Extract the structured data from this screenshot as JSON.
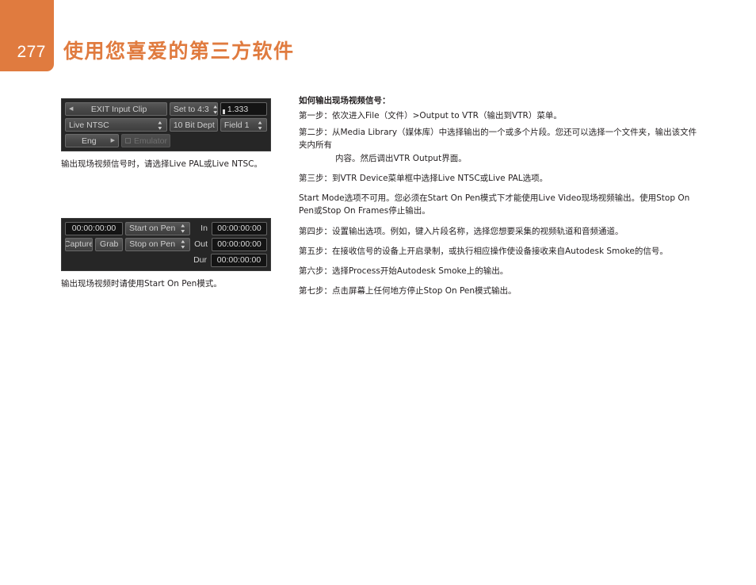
{
  "header": {
    "page_number": "277",
    "title": "使用您喜爱的第三方软件",
    "accent_color": "#e07b3f"
  },
  "figure1": {
    "panel_name": "vtr-output-settings-panel",
    "row1": {
      "clip_button": {
        "label": "EXIT Input Clip",
        "left_arrow": "◀"
      },
      "aspect_menu": {
        "label": "Set to 4:3",
        "spinner": "⇅"
      },
      "ratio_field": {
        "value": "1.333"
      }
    },
    "row2": {
      "device_menu": {
        "label": "Live NTSC",
        "spinner": "⇅"
      },
      "bit_depth_menu": {
        "label": "10 Bit Dept",
        "spinner": "⇅"
      },
      "field_menu": {
        "label": "Field 1",
        "spinner": "⇅"
      }
    },
    "row3": {
      "eng_button": {
        "label": "Eng",
        "right_arrow": "▶"
      },
      "emulator_toggle": {
        "label": "Emulator",
        "enabled": false
      }
    },
    "caption": "输出现场视频信号时，请选择Live PAL或Live NTSC。"
  },
  "figure2": {
    "panel_name": "capture-timecode-panel",
    "timecode_field": {
      "value": "00:00:00:00"
    },
    "capture_button": {
      "label": "Capture"
    },
    "grab_button": {
      "label": "Grab"
    },
    "start_mode_menu": {
      "label": "Start on Pen",
      "spinner": "⇅"
    },
    "stop_mode_menu": {
      "label": "Stop on Pen",
      "spinner": "⇅"
    },
    "in_label": "In",
    "in_value": "00:00:00:00",
    "out_label": "Out",
    "out_value": "00:00:00:00",
    "dur_label": "Dur",
    "dur_value": "00:00:00:00",
    "caption": "输出现场视频时请使用Start On Pen模式。"
  },
  "instructions": {
    "heading": "如何输出现场视频信号：",
    "step1": "第一步：依次进入File（文件）>Output to VTR（输出到VTR）菜单。",
    "step2_main": "第二步：从Media Library（媒体库）中选择输出的一个或多个片段。您还可以选择一个文件夹，输出该文件夹内所有",
    "step2_cont": "内容。然后调出VTR Output界面。",
    "step3": "第三步：到VTR Device菜单框中选择Live NTSC或Live PAL选项。",
    "note": "Start Mode选项不可用。您必须在Start On Pen模式下才能使用Live Video现场视频输出。使用Stop On Pen或Stop On Frames停止输出。",
    "step4": "第四步：设置输出选项。例如，键入片段名称，选择您想要采集的视频轨道和音频通道。",
    "step5": "第五步：在接收信号的设备上开启录制，或执行相应操作使设备接收来自Autodesk Smoke的信号。",
    "step6": "第六步：选择Process开始Autodesk Smoke上的输出。",
    "step7": "第七步：点击屏幕上任何地方停止Stop On Pen模式输出。"
  }
}
